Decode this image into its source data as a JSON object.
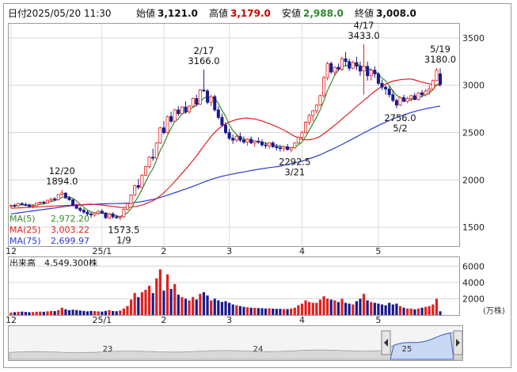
{
  "header": {
    "date_label": "日付",
    "date_value": "2025/05/20 11:30",
    "open_label": "始値",
    "open_value": "3,121.0",
    "high_label": "高値",
    "high_value": "3,179.0",
    "low_label": "安値",
    "low_value": "2,988.0",
    "close_label": "終値",
    "close_value": "3,008.0"
  },
  "colors": {
    "up": "#e02020",
    "down": "#1a1a8c",
    "ma5": "#3a8a2a",
    "ma25": "#e02020",
    "ma75": "#2a3ad6",
    "high": "#cc0000",
    "low": "#2a8a2a"
  },
  "legend": {
    "ma5_label": "MA(5)",
    "ma5_value": "2,972.20",
    "ma25_label": "MA(25)",
    "ma25_value": "3,003.22",
    "ma75_label": "MA(75)",
    "ma75_value": "2,699.97"
  },
  "volume_panel": {
    "label": "出来高",
    "value": "4,549,300株",
    "unit": "(万株)"
  },
  "navigator": {
    "years": [
      "23",
      "24",
      "25"
    ]
  },
  "chart_data": {
    "type": "candlestick",
    "price_axis": {
      "ylim": [
        1300,
        3650
      ],
      "ticks": [
        1500,
        2000,
        2500,
        3000,
        3500
      ]
    },
    "volume_axis": {
      "ylim": [
        0,
        7000
      ],
      "ticks": [
        2000,
        4000,
        6000
      ],
      "unit": "万株"
    },
    "x_month_labels": [
      {
        "label": "12",
        "day": 0
      },
      {
        "label": "25/1",
        "day": 25
      },
      {
        "label": "2",
        "day": 42
      },
      {
        "label": "3",
        "day": 60
      },
      {
        "label": "4",
        "day": 80
      },
      {
        "label": "5",
        "day": 101
      }
    ],
    "annotations": [
      {
        "date": "12/20",
        "value": "1894.0",
        "day": 14,
        "price": 1894,
        "pos": "above"
      },
      {
        "date": "1/9",
        "value": "1573.5",
        "day": 31,
        "price": 1573.5,
        "pos": "below"
      },
      {
        "date": "2/17",
        "value": "3166.0",
        "day": 53,
        "price": 3166,
        "pos": "above"
      },
      {
        "date": "3/21",
        "value": "2292.5",
        "day": 78,
        "price": 2292.5,
        "pos": "below"
      },
      {
        "date": "4/17",
        "value": "3433.0",
        "day": 97,
        "price": 3433,
        "pos": "above"
      },
      {
        "date": "5/2",
        "value": "2756.0",
        "day": 107,
        "price": 2756,
        "pos": "below"
      },
      {
        "date": "5/19",
        "value": "3180.0",
        "day": 118,
        "price": 3180,
        "pos": "above"
      }
    ],
    "series": [
      {
        "name": "MA(5)",
        "value": 2972.2
      },
      {
        "name": "MA(25)",
        "value": 3003.22
      },
      {
        "name": "MA(75)",
        "value": 2699.97
      }
    ],
    "candles": [
      [
        1720,
        1740,
        1700,
        1730,
        300
      ],
      [
        1730,
        1750,
        1710,
        1725,
        350
      ],
      [
        1725,
        1760,
        1715,
        1750,
        400
      ],
      [
        1750,
        1765,
        1730,
        1740,
        420
      ],
      [
        1740,
        1760,
        1720,
        1735,
        380
      ],
      [
        1735,
        1750,
        1710,
        1720,
        350
      ],
      [
        1720,
        1740,
        1700,
        1730,
        360
      ],
      [
        1730,
        1760,
        1720,
        1755,
        400
      ],
      [
        1755,
        1775,
        1740,
        1765,
        420
      ],
      [
        1765,
        1780,
        1745,
        1755,
        400
      ],
      [
        1755,
        1790,
        1750,
        1785,
        450
      ],
      [
        1785,
        1810,
        1770,
        1800,
        500
      ],
      [
        1800,
        1820,
        1780,
        1790,
        480
      ],
      [
        1790,
        1850,
        1785,
        1845,
        600
      ],
      [
        1845,
        1894,
        1830,
        1860,
        900
      ],
      [
        1860,
        1870,
        1800,
        1810,
        700
      ],
      [
        1810,
        1830,
        1780,
        1790,
        600
      ],
      [
        1790,
        1800,
        1720,
        1730,
        650
      ],
      [
        1730,
        1750,
        1690,
        1700,
        600
      ],
      [
        1700,
        1720,
        1660,
        1680,
        550
      ],
      [
        1680,
        1700,
        1640,
        1660,
        500
      ],
      [
        1660,
        1680,
        1620,
        1640,
        450
      ],
      [
        1640,
        1660,
        1600,
        1630,
        500
      ],
      [
        1630,
        1660,
        1610,
        1650,
        480
      ],
      [
        1650,
        1680,
        1630,
        1670,
        450
      ],
      [
        1670,
        1690,
        1640,
        1650,
        420
      ],
      [
        1650,
        1660,
        1590,
        1600,
        500
      ],
      [
        1600,
        1650,
        1585,
        1640,
        600
      ],
      [
        1640,
        1660,
        1590,
        1610,
        480
      ],
      [
        1610,
        1630,
        1590,
        1600,
        470
      ],
      [
        1600,
        1620,
        1573.5,
        1610,
        550
      ],
      [
        1610,
        1700,
        1600,
        1690,
        800
      ],
      [
        1690,
        1760,
        1680,
        1750,
        1100
      ],
      [
        1750,
        1850,
        1740,
        1840,
        1900
      ],
      [
        1840,
        1950,
        1830,
        1940,
        2700
      ],
      [
        1940,
        2010,
        1900,
        1920,
        2200
      ],
      [
        1920,
        2060,
        1910,
        2050,
        2800
      ],
      [
        2050,
        2150,
        2040,
        2140,
        3100
      ],
      [
        2140,
        2250,
        2120,
        2240,
        3600
      ],
      [
        2240,
        2330,
        2200,
        2230,
        2700
      ],
      [
        2230,
        2400,
        2220,
        2390,
        4500
      ],
      [
        2390,
        2560,
        2380,
        2550,
        5600
      ],
      [
        2550,
        2620,
        2480,
        2500,
        3000
      ],
      [
        2500,
        2680,
        2490,
        2670,
        5000
      ],
      [
        2670,
        2720,
        2600,
        2620,
        3200
      ],
      [
        2620,
        2750,
        2610,
        2740,
        3800
      ],
      [
        2740,
        2780,
        2680,
        2700,
        2500
      ],
      [
        2700,
        2780,
        2690,
        2770,
        2200
      ],
      [
        2770,
        2830,
        2700,
        2720,
        2000
      ],
      [
        2720,
        2790,
        2700,
        2780,
        1800
      ],
      [
        2780,
        2870,
        2770,
        2860,
        2200
      ],
      [
        2860,
        2900,
        2780,
        2800,
        1900
      ],
      [
        2800,
        2960,
        2790,
        2950,
        2600
      ],
      [
        2950,
        3166,
        2930,
        2940,
        2800
      ],
      [
        2940,
        2960,
        2800,
        2820,
        2400
      ],
      [
        2820,
        2900,
        2780,
        2880,
        1800
      ],
      [
        2880,
        2900,
        2720,
        2740,
        2000
      ],
      [
        2740,
        2780,
        2640,
        2660,
        1800
      ],
      [
        2660,
        2700,
        2560,
        2580,
        1600
      ],
      [
        2580,
        2610,
        2480,
        2500,
        1700
      ],
      [
        2500,
        2540,
        2420,
        2440,
        1500
      ],
      [
        2440,
        2480,
        2380,
        2420,
        1300
      ],
      [
        2420,
        2480,
        2400,
        2460,
        1200
      ],
      [
        2460,
        2500,
        2400,
        2420,
        1100
      ],
      [
        2420,
        2460,
        2380,
        2400,
        1000
      ],
      [
        2400,
        2440,
        2360,
        2430,
        950
      ],
      [
        2430,
        2460,
        2380,
        2390,
        900
      ],
      [
        2390,
        2420,
        2350,
        2410,
        880
      ],
      [
        2410,
        2450,
        2380,
        2400,
        850
      ],
      [
        2400,
        2430,
        2350,
        2370,
        830
      ],
      [
        2370,
        2400,
        2330,
        2360,
        800
      ],
      [
        2360,
        2400,
        2330,
        2390,
        820
      ],
      [
        2390,
        2410,
        2340,
        2350,
        780
      ],
      [
        2350,
        2380,
        2310,
        2340,
        760
      ],
      [
        2340,
        2370,
        2300,
        2330,
        760
      ],
      [
        2330,
        2360,
        2300,
        2350,
        740
      ],
      [
        2350,
        2380,
        2310,
        2320,
        720
      ],
      [
        2320,
        2350,
        2292.5,
        2340,
        800
      ],
      [
        2340,
        2400,
        2330,
        2390,
        900
      ],
      [
        2390,
        2460,
        2380,
        2450,
        1200
      ],
      [
        2450,
        2520,
        2430,
        2500,
        1400
      ],
      [
        2500,
        2620,
        2490,
        2610,
        1800
      ],
      [
        2610,
        2700,
        2580,
        2680,
        1600
      ],
      [
        2680,
        2740,
        2620,
        2730,
        1500
      ],
      [
        2730,
        2800,
        2700,
        2790,
        1500
      ],
      [
        2790,
        2900,
        2780,
        2890,
        1900
      ],
      [
        2890,
        3100,
        2870,
        3080,
        2300
      ],
      [
        3080,
        3250,
        3050,
        3230,
        2000
      ],
      [
        3230,
        3250,
        3120,
        3140,
        1900
      ],
      [
        3140,
        3200,
        3100,
        3190,
        1800
      ],
      [
        3190,
        3230,
        3150,
        3170,
        1600
      ],
      [
        3170,
        3300,
        3150,
        3280,
        2000
      ],
      [
        3280,
        3350,
        3200,
        3250,
        1500
      ],
      [
        3250,
        3280,
        3150,
        3180,
        1400
      ],
      [
        3180,
        3260,
        3170,
        3240,
        1300
      ],
      [
        3240,
        3300,
        3160,
        3200,
        1700
      ],
      [
        3200,
        3250,
        3100,
        3150,
        2000
      ],
      [
        3150,
        3433,
        2900,
        3200,
        2600
      ],
      [
        3200,
        3250,
        3050,
        3100,
        1800
      ],
      [
        3100,
        3180,
        3050,
        3160,
        1600
      ],
      [
        3160,
        3200,
        3080,
        3120,
        1500
      ],
      [
        3120,
        3140,
        3000,
        3020,
        1400
      ],
      [
        3020,
        3060,
        2950,
        2980,
        1300
      ],
      [
        2980,
        3000,
        2900,
        2960,
        1200
      ],
      [
        2960,
        2990,
        2870,
        2900,
        1500
      ],
      [
        2900,
        2950,
        2820,
        2840,
        1300
      ],
      [
        2840,
        2860,
        2756,
        2790,
        1400
      ],
      [
        2790,
        2880,
        2780,
        2870,
        1100
      ],
      [
        2870,
        2900,
        2820,
        2830,
        900
      ],
      [
        2830,
        2880,
        2810,
        2860,
        800
      ],
      [
        2860,
        2900,
        2830,
        2890,
        800
      ],
      [
        2890,
        2920,
        2840,
        2850,
        700
      ],
      [
        2850,
        2930,
        2840,
        2920,
        800
      ],
      [
        2920,
        2950,
        2870,
        2900,
        900
      ],
      [
        2900,
        2960,
        2880,
        2940,
        1000
      ],
      [
        2940,
        3000,
        2900,
        2960,
        1100
      ],
      [
        2960,
        3060,
        2950,
        3050,
        1300
      ],
      [
        3050,
        3180,
        3040,
        3160,
        2000
      ],
      [
        3121,
        3179,
        2988,
        3008,
        455
      ]
    ]
  }
}
